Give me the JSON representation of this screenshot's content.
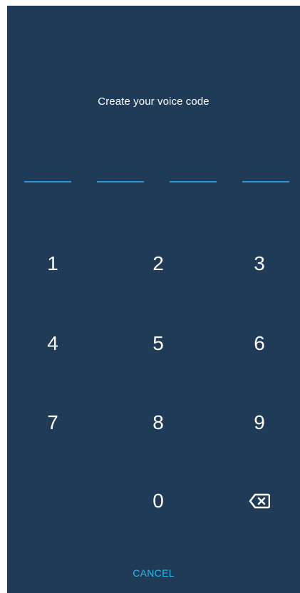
{
  "screen": {
    "title": "Create your voice code",
    "pin_length": 4
  },
  "keypad": {
    "keys": [
      "1",
      "2",
      "3",
      "4",
      "5",
      "6",
      "7",
      "8",
      "9",
      "0"
    ],
    "backspace_icon": "backspace-icon"
  },
  "actions": {
    "cancel_label": "CANCEL"
  },
  "colors": {
    "background": "#1f3b58",
    "accent": "#2f9bd2",
    "cancel": "#29b8e8",
    "text": "#ffffff"
  }
}
